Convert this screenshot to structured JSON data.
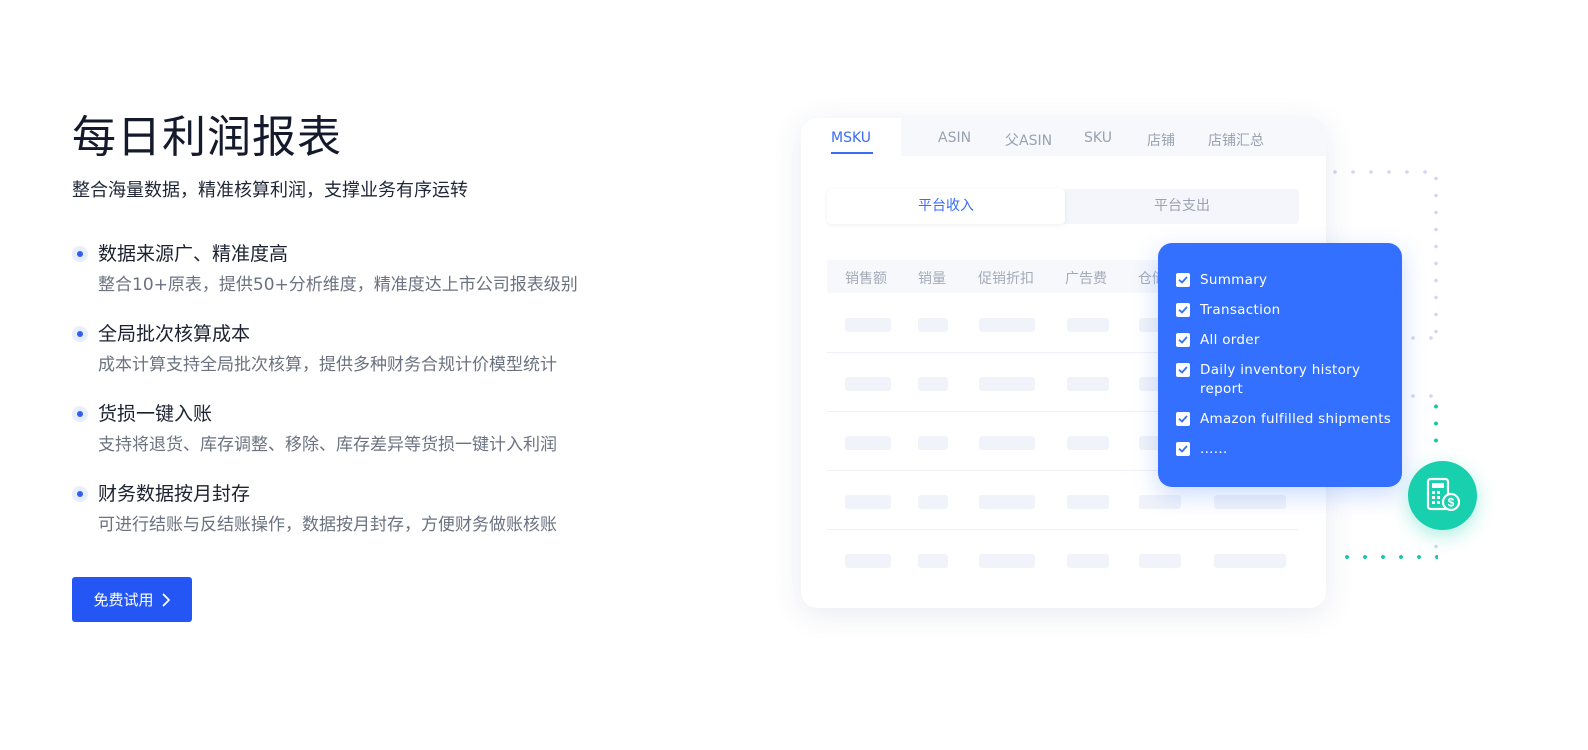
{
  "hero": {
    "title": "每日利润报表",
    "subtitle": "整合海量数据，精准核算利润，支撑业务有序运转",
    "cta_label": "免费试用"
  },
  "features": [
    {
      "title": "数据来源广、精准度高",
      "desc": "整合10+原表，提供50+分析维度，精准度达上市公司报表级别"
    },
    {
      "title": "全局批次核算成本",
      "desc": "成本计算支持全局批次核算，提供多种财务合规计价模型统计"
    },
    {
      "title": "货损一键入账",
      "desc": "支持将退货、库存调整、移除、库存差异等货损一键计入利润"
    },
    {
      "title": "财务数据按月封存",
      "desc": "可进行结账与反结账操作，数据按月封存，方便财务做账核账"
    }
  ],
  "report_card": {
    "tabs": [
      "MSKU",
      "ASIN",
      "父ASIN",
      "SKU",
      "店铺",
      "店铺汇总"
    ],
    "active_tab": "MSKU",
    "segments": [
      "平台收入",
      "平台支出"
    ],
    "active_segment": "平台收入",
    "columns": [
      "销售额",
      "销量",
      "促销折扣",
      "广告费",
      "仓储"
    ]
  },
  "popup": {
    "items": [
      "Summary",
      "Transaction",
      "All order",
      "Daily inventory history report",
      "Amazon fulfilled shipments",
      "......"
    ]
  },
  "colors": {
    "primary": "#2456f5",
    "popup_bg": "#3370ff",
    "accent_teal": "#18cfae",
    "tab_active": "#3a6cf6"
  },
  "icons": {
    "cta": "chevron-right-icon",
    "checkbox": "checkmark-icon",
    "badge": "calculator-dollar-icon"
  }
}
